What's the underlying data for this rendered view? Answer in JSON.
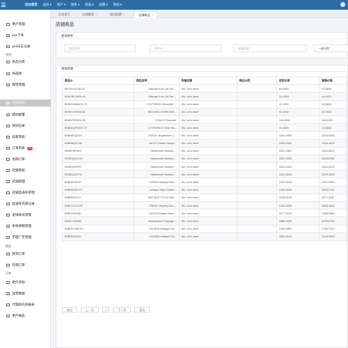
{
  "topbar": {
    "items": [
      "后台首页",
      "会员 ▾",
      "用户 ▾",
      "财务 ▾",
      "商品 ▾",
      "配置 ▾",
      "系统 ▾"
    ]
  },
  "sidebar": {
    "items": [
      {
        "label": "用户管理"
      },
      {
        "label": "pos下单"
      },
      {
        "label": "pos日志记录"
      },
      {
        "label": "商品分类"
      },
      {
        "label": "商品库"
      },
      {
        "label": "属性管理"
      },
      {
        "label": "店铺商品"
      },
      {
        "label": "级别配置"
      },
      {
        "label": "级别记录"
      },
      {
        "label": "卖家审核"
      },
      {
        "label": "订单列表",
        "badge": "70"
      },
      {
        "label": "退款订单"
      },
      {
        "label": "店铺审核"
      },
      {
        "label": "店铺管理"
      },
      {
        "label": "店铺直通车管理"
      },
      {
        "label": "直通车充值记录"
      },
      {
        "label": "虚拟账号管理"
      },
      {
        "label": "系统邮箱管理"
      },
      {
        "label": "页面广告管理"
      },
      {
        "label": "提现订单"
      },
      {
        "label": "充值订单"
      },
      {
        "label": "用户存款"
      },
      {
        "label": "运营数据"
      },
      {
        "label": "代理商充值报表"
      },
      {
        "label": "用户报表"
      }
    ],
    "groups": [
      "会员",
      "财务",
      "订单",
      "报表"
    ]
  },
  "tabs": [
    {
      "label": "后台首页"
    },
    {
      "label": "店铺管理"
    },
    {
      "label": "级别配置"
    },
    {
      "label": "店铺商品"
    }
  ],
  "page": {
    "title": "店铺商品"
  },
  "search": {
    "title": "查询条件",
    "product_name_placeholder": "商品名称",
    "user_id_placeholder": "用户ID",
    "shop_name_placeholder": "店铺名称",
    "category_value": "一级分类"
  },
  "results": {
    "title": "查询结果",
    "columns": [
      "商品ID",
      "商品名称",
      "所属店铺",
      "商品分类",
      "进货价格",
      "销售价格"
    ],
    "rows": [
      [
        "B07XFG4738-87",
        "Michael Kors Jet Set ...",
        "Ms. Lin's store",
        "",
        "69.8900",
        "97.8600"
      ],
      [
        "B08CBLS49X-89",
        "Michael Kors Jet Set ...",
        "Ms. Lin's store",
        "",
        "31.4300",
        "44.0020"
      ],
      [
        "B09SKNMNCZ-78",
        "CYHTWSDJ Shoulder ...",
        "Ms. Lin's store",
        "",
        "11.1900",
        "15.6660"
      ],
      [
        "B096TG3H38-80",
        "MICHAEL KORS MIR...",
        "Ms. Lin's store",
        "",
        "64.4000",
        "90.1600"
      ],
      [
        "B08NT52NDV-99",
        "COACH Shoulder",
        "Ms. Lin's store",
        "",
        "104.6500",
        "146.5100"
      ],
      [
        "B0B62QF9GW-79",
        "CYHTWSDJ Clear Ba...",
        "Ms. Lin's store",
        "",
        "10.4800",
        "14.6800"
      ],
      [
        "B0B9RZQX43",
        "ZSEDP Jingdezhen C...",
        "Ms. Lin's store",
        "",
        "1431.0900",
        "2003.9460"
      ],
      [
        "B0B5BQ574M",
        "ZHYH Classic Antiqu...",
        "Ms. Lin's store",
        "",
        "1026.0300",
        "1436.4420"
      ],
      [
        "B092P6FNH3",
        "Handmade Stained ...",
        "Ms. Lin's store",
        "",
        "2031.1600",
        "2843.6240"
      ],
      [
        "B092Q2811X3",
        "Handmade Stained ...",
        "Ms. Lin's store",
        "",
        "2031.3400",
        "2843.8760"
      ],
      [
        "B092Q2RDF2",
        "Handmade Stained ...",
        "Ms. Lin's store",
        "",
        "2031.1600",
        "2843.6240"
      ],
      [
        "B092Q15CPD",
        "Handmade Stained ...",
        "Ms. Lin's store",
        "",
        "2013.8100",
        "2819.3340"
      ],
      [
        "B0B0D261N1",
        "HOUKAI Antique Vas...",
        "Ms. Lin's store",
        "",
        "1337.5200",
        "1872.5280"
      ],
      [
        "B0B9SG82CG",
        "Antique Style Diamo...",
        "Ms. Lin's store",
        "",
        "1443.0500",
        "2020.2700"
      ],
      [
        "B0B9ERG1O",
        "ANTIQUE STYLE MO...",
        "Ms. Lin's store",
        "",
        "1126.5100",
        "1577.1140"
      ],
      [
        "B0BZ7C2CGR",
        "ZSEDP Jewelry Box ...",
        "Ms. Lin's store",
        "",
        "1332.8000",
        "1866.1800"
      ],
      [
        "B0BST6LK5H",
        "ZSEDP Antique Blue ...",
        "Ms. Lin's store",
        "",
        "1277.5700",
        "1788.5980"
      ],
      [
        "B09XTG5D50",
        "Masterpiece Engrage...",
        "Ms. Lin's store",
        "",
        "2668.0500",
        "3735.2700"
      ],
      [
        "B0B9XYWDXH",
        "HOUKAI Antique Chi...",
        "Ms. Lin's store",
        "",
        "1254.0800",
        "1755.7120"
      ],
      [
        "B0B9RSQ52L",
        "HOUKAI Antique Chi...",
        "Ms. Lin's store",
        "",
        "1532.2100",
        "2145.0940"
      ]
    ]
  },
  "pager": {
    "first": "首页",
    "prev": "上一页",
    "current": "1",
    "next": "下一页",
    "last": "尾页"
  }
}
